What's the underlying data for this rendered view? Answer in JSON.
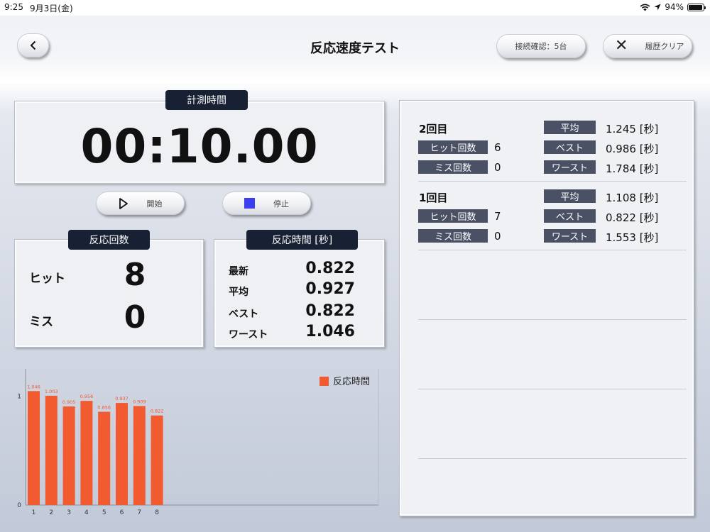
{
  "status_bar": {
    "time": "9:25",
    "date": "9月3日(金)",
    "battery": "94%",
    "battery_level": 0.94
  },
  "header": {
    "title": "反応速度テスト",
    "connection_label": "接続確認：5台",
    "clear_label": "履歴クリア"
  },
  "timer": {
    "label": "計測時間",
    "value": "00:10.00"
  },
  "controls": {
    "start_label": "開始",
    "stop_label": "停止"
  },
  "counts": {
    "label": "反応回数",
    "hit_label": "ヒット",
    "hit_value": "8",
    "miss_label": "ミス",
    "miss_value": "0"
  },
  "reaction": {
    "label": "反応時間 [秒]",
    "rows": [
      {
        "label": "最新",
        "value": "0.822"
      },
      {
        "label": "平均",
        "value": "0.927"
      },
      {
        "label": "ベスト",
        "value": "0.822"
      },
      {
        "label": "ワースト",
        "value": "1.046"
      }
    ]
  },
  "chart_data": {
    "type": "bar",
    "categories": [
      "1",
      "2",
      "3",
      "4",
      "5",
      "6",
      "7",
      "8"
    ],
    "series": [
      {
        "name": "反応時間",
        "values": [
          1.046,
          1.003,
          0.905,
          0.956,
          0.856,
          0.937,
          0.909,
          0.822
        ]
      }
    ],
    "ylim": [
      0,
      1.25
    ],
    "yticks": [
      "0",
      "1"
    ],
    "legend": "top-right",
    "color": "#f25a2f"
  },
  "history": [
    {
      "round": "2回目",
      "hit_label": "ヒット回数",
      "hit_value": "6",
      "miss_label": "ミス回数",
      "miss_value": "0",
      "avg_label": "平均",
      "avg_value": "1.245 [秒]",
      "best_label": "ベスト",
      "best_value": "0.986 [秒]",
      "worst_label": "ワースト",
      "worst_value": "1.784 [秒]"
    },
    {
      "round": "1回目",
      "hit_label": "ヒット回数",
      "hit_value": "7",
      "miss_label": "ミス回数",
      "miss_value": "0",
      "avg_label": "平均",
      "avg_value": "1.108 [秒]",
      "best_label": "ベスト",
      "best_value": "0.822 [秒]",
      "worst_label": "ワースト",
      "worst_value": "1.553 [秒]"
    }
  ]
}
